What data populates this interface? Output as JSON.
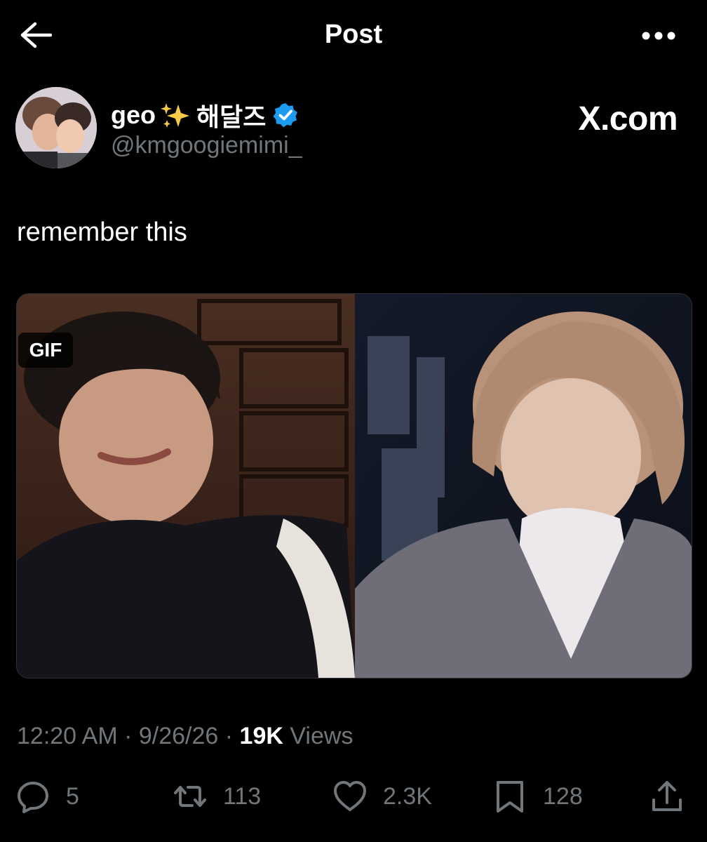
{
  "header": {
    "title": "Post"
  },
  "author": {
    "display_name": "geo",
    "name_suffix": "해달즈",
    "handle": "@kmgoogiemimi_",
    "verified": true
  },
  "watermark": "X.com",
  "post": {
    "text": "remember this",
    "media_badge": "GIF"
  },
  "meta": {
    "time": "12:20 AM",
    "sep1": " · ",
    "date": "9/26/26",
    "sep2": " · ",
    "views_count": "19K",
    "views_label": " Views"
  },
  "actions": {
    "replies": "5",
    "reposts": "113",
    "likes": "2.3K",
    "bookmarks": "128"
  },
  "colors": {
    "background": "#000000",
    "text": "#e7e9ea",
    "muted": "#71767b",
    "verified": "#1d9bf0",
    "sparkle": "#f7c948"
  },
  "icons": [
    "back-arrow-icon",
    "more-icon",
    "sparkles-icon",
    "verified-badge-icon",
    "reply-icon",
    "repost-icon",
    "like-icon",
    "bookmark-icon",
    "share-icon"
  ]
}
